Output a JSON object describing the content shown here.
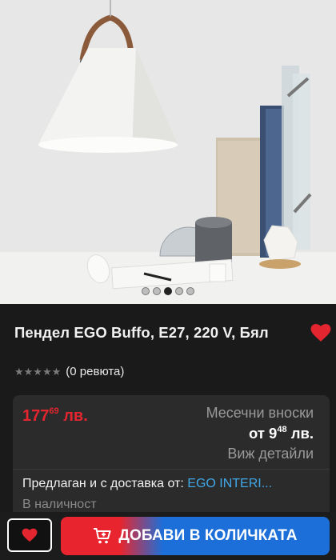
{
  "product": {
    "title": "Пендел EGO Buffo, E27, 220 V, Бял",
    "image_alt": "white pendant lamp with leather strap",
    "gallery": {
      "count": 5,
      "active_index": 2
    }
  },
  "rating": {
    "stars": "★★★★★",
    "reviews_label": "(0 ревюта)"
  },
  "price": {
    "main": "177",
    "cents": "69",
    "currency": "лв."
  },
  "installments": {
    "label": "Месечни вноски",
    "prefix": "от",
    "amount": "9",
    "cents": "48",
    "currency": "лв.",
    "details_link": "Виж детайли"
  },
  "seller": {
    "label": "Предлаган и с доставка от:",
    "name": "EGO INTERI..."
  },
  "stock": {
    "label": "В наличност"
  },
  "actions": {
    "add_to_cart": "ДОБАВИ В КОЛИЧКАТА"
  },
  "colors": {
    "accent_red": "#e3252f",
    "cart_blue": "#1c6fd8",
    "link_blue": "#41a8e8"
  }
}
